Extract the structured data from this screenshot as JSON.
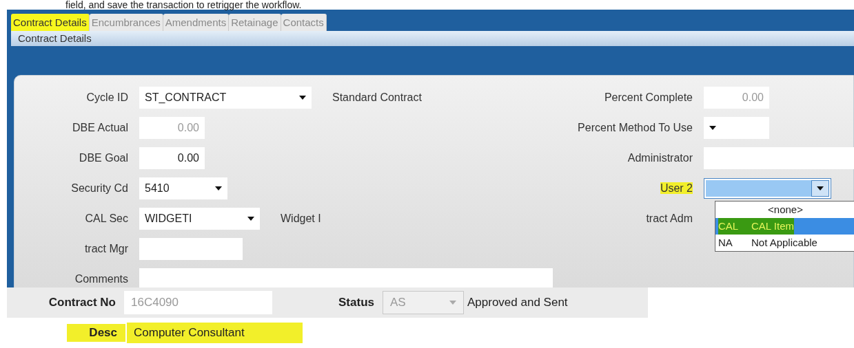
{
  "caption": "field, and save the transaction to retrigger the workflow.",
  "tabs": [
    {
      "label": "Contract Details",
      "selected": true,
      "highlighted": true
    },
    {
      "label": "Encumbrances",
      "selected": false,
      "highlighted": false
    },
    {
      "label": "Amendments",
      "selected": false,
      "highlighted": false
    },
    {
      "label": "Retainage",
      "selected": false,
      "highlighted": false
    },
    {
      "label": "Contacts",
      "selected": false,
      "highlighted": false
    }
  ],
  "section_title": "Contract Details",
  "left_fields": [
    {
      "label": "Cycle ID",
      "kind": "dropdown",
      "value": "ST_CONTRACT",
      "description": "Standard Contract"
    },
    {
      "label": "DBE Actual",
      "kind": "number",
      "value": "0.00",
      "disabled": true
    },
    {
      "label": "DBE Goal",
      "kind": "number",
      "value": "0.00",
      "disabled": false
    },
    {
      "label": "Security Cd",
      "kind": "dropdown",
      "value": "5410"
    },
    {
      "label": "CAL Sec",
      "kind": "dropdown",
      "value": "WIDGETI",
      "description": "Widget I"
    },
    {
      "label": "tract Mgr",
      "kind": "text"
    },
    {
      "label": "Comments",
      "kind": "text"
    }
  ],
  "right_fields": [
    {
      "label": "Percent Complete",
      "kind": "number",
      "value": "0.00",
      "disabled": true
    },
    {
      "label": "Percent Method To Use",
      "kind": "dropdown"
    },
    {
      "label": "Administrator",
      "kind": "text"
    },
    {
      "label": "User 2",
      "kind": "combo",
      "highlighted": true,
      "expanded": true,
      "options": [
        {
          "text": "<none>",
          "selected": false,
          "highlighted": false
        },
        {
          "code": "CAL",
          "text": "CAL Item",
          "selected": true,
          "highlighted": true
        },
        {
          "code": "NA",
          "text": "Not Applicable",
          "selected": false,
          "highlighted": false
        }
      ]
    },
    {
      "label": "tract Adm",
      "kind": "hidden"
    }
  ],
  "header": [
    {
      "label": "Contract No",
      "value": "16C4090",
      "kind": "text",
      "disabled": true
    },
    {
      "label": "Status",
      "value": "AS",
      "kind": "dropdown",
      "disabled": true,
      "description": "Approved and Sent"
    },
    {
      "label": "Desc",
      "value": "Computer Consultant",
      "kind": "plain",
      "highlighted": true
    }
  ]
}
